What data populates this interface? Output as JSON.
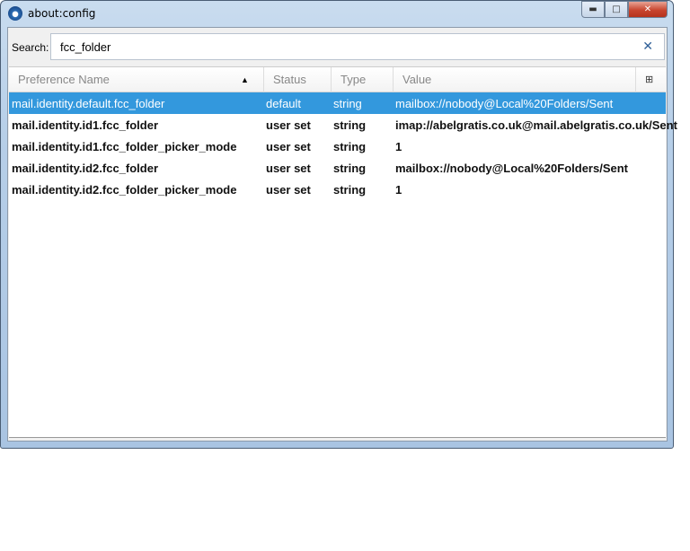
{
  "window": {
    "title": "about:config"
  },
  "search": {
    "label": "Search:",
    "value": "fcc_folder",
    "clear": "✕"
  },
  "columns": [
    "Preference Name",
    "Status",
    "Type",
    "Value"
  ],
  "sort_indicator": "▲",
  "rows": [
    {
      "name": "mail.identity.default.fcc_folder",
      "status": "default",
      "type": "string",
      "value": "mailbox://nobody@Local%20Folders/Sent"
    },
    {
      "name": "mail.identity.id1.fcc_folder",
      "status": "user set",
      "type": "string",
      "value": "imap://abelgratis.co.uk@mail.abelgratis.co.uk/Sent"
    },
    {
      "name": "mail.identity.id1.fcc_folder_picker_mode",
      "status": "user set",
      "type": "string",
      "value": "1"
    },
    {
      "name": "mail.identity.id2.fcc_folder",
      "status": "user set",
      "type": "string",
      "value": "mailbox://nobody@Local%20Folders/Sent"
    },
    {
      "name": "mail.identity.id2.fcc_folder_picker_mode",
      "status": "user set",
      "type": "string",
      "value": "1"
    }
  ]
}
